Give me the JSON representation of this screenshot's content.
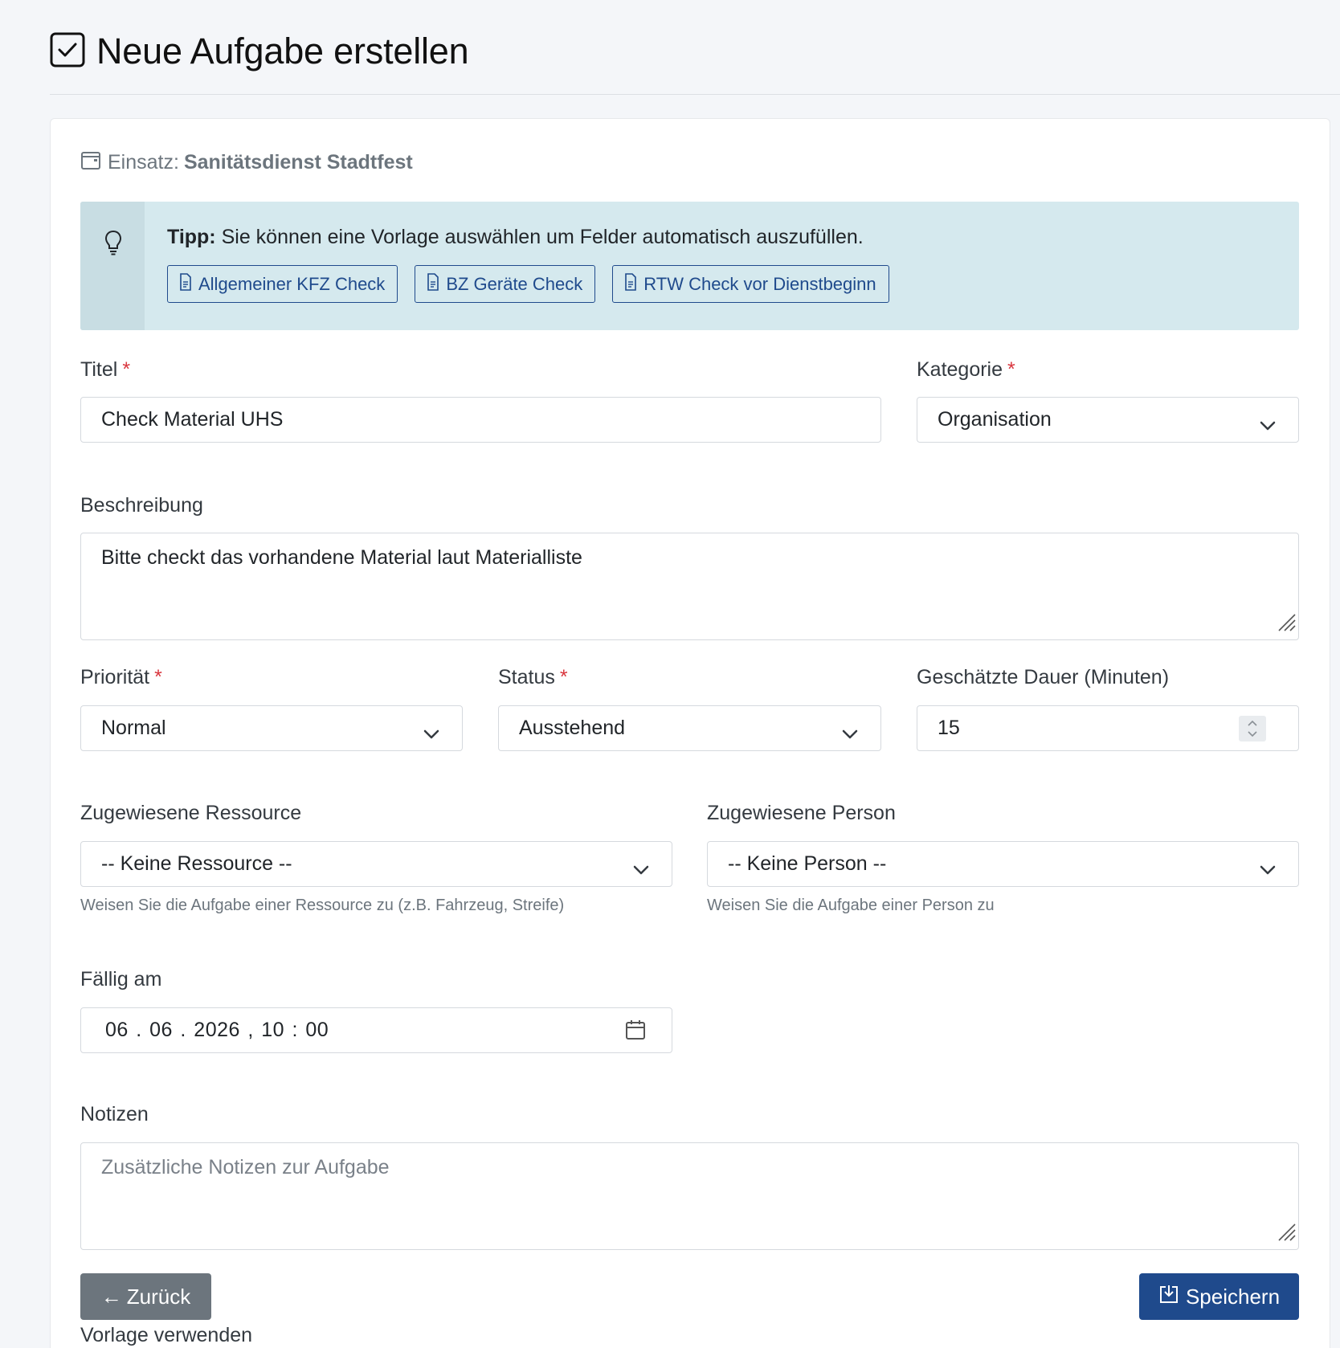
{
  "page": {
    "title": "Neue Aufgabe erstellen"
  },
  "context": {
    "label": "Einsatz:",
    "value": "Sanitätsdienst Stadtfest"
  },
  "tip": {
    "bold": "Tipp:",
    "text": " Sie können eine Vorlage auswählen um Felder automatisch auszufüllen.",
    "templates": [
      "Allgemeiner KFZ Check",
      "BZ Geräte Check",
      "RTW Check vor Dienstbeginn"
    ]
  },
  "form": {
    "titel": {
      "label": "Titel",
      "value": "Check Material UHS"
    },
    "kategorie": {
      "label": "Kategorie",
      "value": "Organisation"
    },
    "beschreibung": {
      "label": "Beschreibung",
      "value": "Bitte checkt das vorhandene Material laut Materialliste"
    },
    "prioritaet": {
      "label": "Priorität",
      "value": "Normal"
    },
    "status": {
      "label": "Status",
      "value": "Ausstehend"
    },
    "dauer": {
      "label": "Geschätzte Dauer (Minuten)",
      "value": "15"
    },
    "ressource": {
      "label": "Zugewiesene Ressource",
      "value": "-- Keine Ressource --",
      "hint": "Weisen Sie die Aufgabe einer Ressource zu (z.B. Fahrzeug, Streife)"
    },
    "person": {
      "label": "Zugewiesene Person",
      "value": "-- Keine Person --",
      "hint": "Weisen Sie die Aufgabe einer Person zu"
    },
    "faellig": {
      "label": "Fällig am",
      "value": "06 . 06 . 2026 ,  10 : 00"
    },
    "notizen": {
      "label": "Notizen",
      "placeholder": "Zusätzliche Notizen zur Aufgabe"
    },
    "required_marker": "*"
  },
  "actions": {
    "back": "Zurück",
    "back_arrow": "←",
    "save": "Speichern",
    "template_heading": "Vorlage verwenden"
  },
  "colors": {
    "primary": "#1f4a8c",
    "secondary": "#6c757d",
    "tip_bg": "#d5e9ee",
    "required": "#d9363e"
  }
}
